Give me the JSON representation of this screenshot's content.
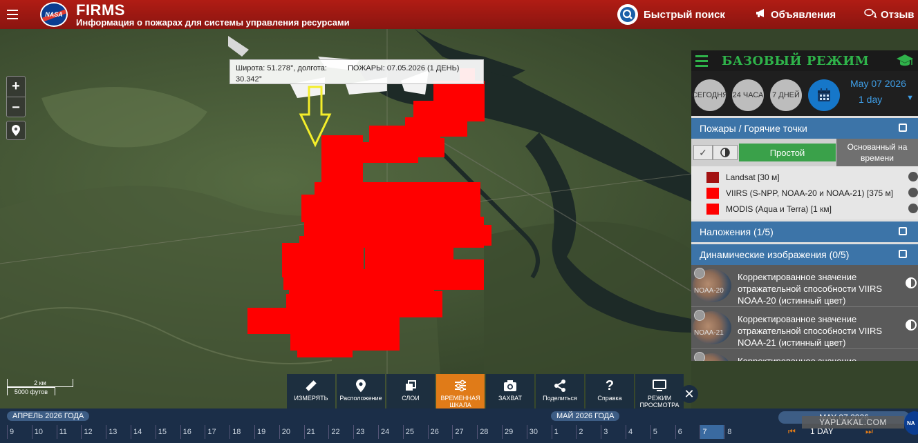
{
  "header": {
    "nasa_logo_text": "NASA",
    "title": "FIRMS",
    "subtitle": "Информация о пожарах для системы управления ресурсами",
    "quick_search": "Быстрый поиск",
    "announcements": "Объявления",
    "feedback": "Отзыв"
  },
  "map": {
    "coords_lat": "Широта: 51.278°, долгота:",
    "coords_lon": "30.342°",
    "fires_date": "ПОЖАРЫ: 07.05.2026 (1 ДЕНЬ)",
    "zoom_in": "+",
    "zoom_out": "−",
    "scale_km": "2 км",
    "scale_ft": "5000 футов",
    "fire_color": "#ff0000",
    "arrow_color": "#f4ee2a"
  },
  "panel": {
    "title": "БАЗОВЫЙ РЕЖИМ",
    "btn_today": "СЕГОДНЯ",
    "btn_24h": "24 ЧАСА",
    "btn_7d": "7 ДНЕЙ",
    "date": "May 07 2026",
    "range": "1 day",
    "fires_section": "Пожары / Горячие точки",
    "mode_simple": "Простой",
    "mode_time": "Основанный на времени",
    "legend": [
      {
        "label": "Landsat [30 м]",
        "color": "#a31212"
      },
      {
        "label": "VIIRS (S-NPP, NOAA-20 и NOAA-21) [375 м]",
        "color": "#ff0000"
      },
      {
        "label": "MODIS (Aqua и Terra) [1 км]",
        "color": "#ff0000"
      }
    ],
    "overlays_section": "Наложения (1/5)",
    "dynamic_section": "Динамические изображения (0/5)",
    "dynamic_items": [
      {
        "sat": "NOAA-20",
        "text": "Корректированное значение отражательной способности VIIRS NOAA-20 (истинный цвет)"
      },
      {
        "sat": "NOAA-21",
        "text": "Корректированное значение отражательной способности VIIRS NOAA-21 (истинный цвет)"
      },
      {
        "sat": "",
        "text": "Корректированное значение отражательнос"
      }
    ]
  },
  "toolbar": {
    "measure": "ИЗМЕРЯТЬ",
    "location": "Расположение",
    "layers": "СЛОИ",
    "timeline": "ВРЕМЕННАЯ ШКАЛА",
    "capture": "ЗАХВАТ",
    "share": "Поделиться",
    "help": "Справка",
    "view_mode": "РЕЖИМ ПРОСМОТРА",
    "close": "✕"
  },
  "timeline": {
    "month_april": "АПРЕЛЬ 2026 ГОДА",
    "month_may": "МАЙ 2026 ГОДА",
    "days": [
      "9",
      "10",
      "11",
      "12",
      "13",
      "14",
      "15",
      "16",
      "17",
      "18",
      "19",
      "20",
      "21",
      "22",
      "23",
      "24",
      "25",
      "26",
      "27",
      "28",
      "29",
      "30",
      "1",
      "2",
      "3",
      "4",
      "5",
      "6",
      "7",
      "8"
    ],
    "selected_day": "7",
    "date": "MAY 07 2026",
    "range": "1 DAY",
    "watermark": "YAPLAKAL.COM"
  }
}
